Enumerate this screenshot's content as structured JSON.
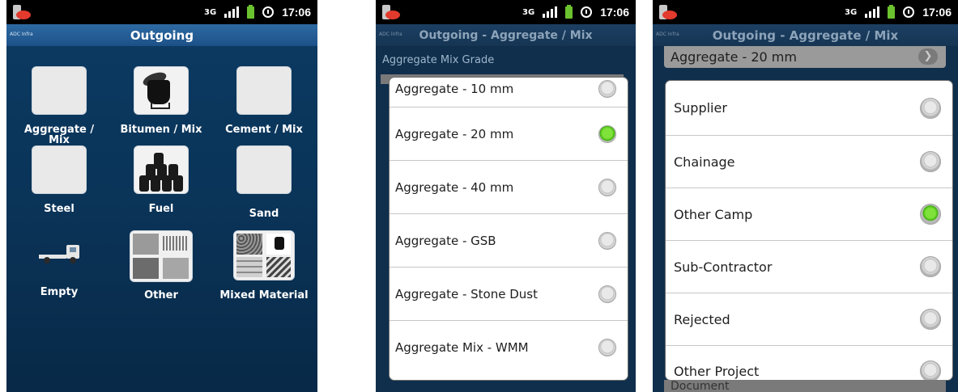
{
  "status_bar": {
    "network": "3G",
    "time": "17:06"
  },
  "screen1": {
    "logo": "ADC Infra",
    "title": "Outgoing",
    "tiles": [
      {
        "label": "Aggregate / Mix"
      },
      {
        "label": "Bitumen / Mix"
      },
      {
        "label": "Cement / Mix"
      },
      {
        "label": "Steel"
      },
      {
        "label": "Fuel"
      },
      {
        "label": "Sand"
      },
      {
        "label": "Empty"
      },
      {
        "label": "Other"
      },
      {
        "label": "Mixed Material"
      }
    ]
  },
  "screen2": {
    "logo": "ADC Infra",
    "title": "Outgoing - Aggregate / Mix",
    "field_label": "Aggregate Mix Grade",
    "options": [
      {
        "label": "Aggregate - 10 mm",
        "selected": false
      },
      {
        "label": "Aggregate - 20 mm",
        "selected": true
      },
      {
        "label": "Aggregate - 40 mm",
        "selected": false
      },
      {
        "label": "Aggregate - GSB",
        "selected": false
      },
      {
        "label": "Aggregate - Stone Dust",
        "selected": false
      },
      {
        "label": "Aggregate Mix - WMM",
        "selected": false
      }
    ]
  },
  "screen3": {
    "logo": "ADC Infra",
    "title": "Outgoing - Aggregate / Mix",
    "field_value": "Aggregate - 20 mm",
    "bottom_field": "Document",
    "options": [
      {
        "label": "Supplier",
        "selected": false
      },
      {
        "label": "Chainage",
        "selected": false
      },
      {
        "label": "Other Camp",
        "selected": true
      },
      {
        "label": "Sub-Contractor",
        "selected": false
      },
      {
        "label": "Rejected",
        "selected": false
      },
      {
        "label": "Other Project",
        "selected": false
      }
    ]
  }
}
